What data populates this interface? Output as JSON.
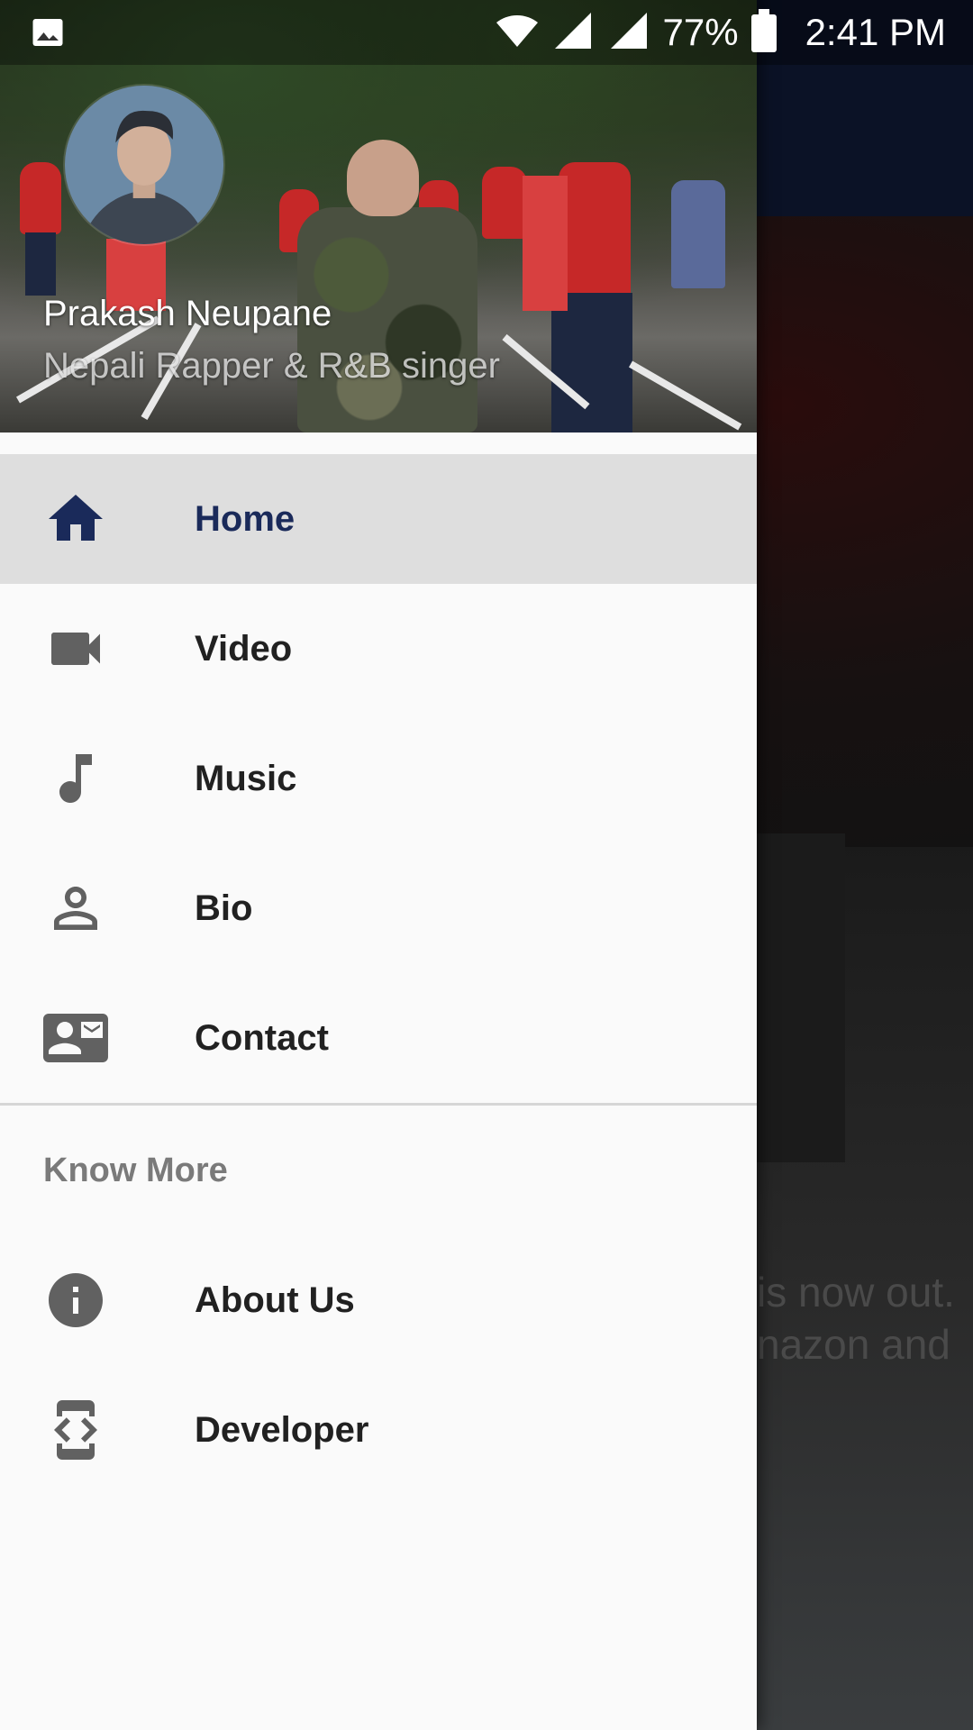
{
  "status_bar": {
    "battery_percent": "77%",
    "time": "2:41 PM"
  },
  "drawer": {
    "header": {
      "name": "Prakash Neupane",
      "subtitle": "Nepali Rapper & R&B singer"
    },
    "items": [
      {
        "label": "Home",
        "icon": "home-icon",
        "active": true
      },
      {
        "label": "Video",
        "icon": "videocam-icon",
        "active": false
      },
      {
        "label": "Music",
        "icon": "music-note-icon",
        "active": false
      },
      {
        "label": "Bio",
        "icon": "person-icon",
        "active": false
      },
      {
        "label": "Contact",
        "icon": "contact-mail-icon",
        "active": false
      }
    ],
    "section": {
      "title": "Know More",
      "items": [
        {
          "label": "About Us",
          "icon": "info-icon"
        },
        {
          "label": "Developer",
          "icon": "developer-mode-icon"
        }
      ]
    }
  },
  "background_app": {
    "visible_text_line1": "is now out.",
    "visible_text_line2": "nazon and"
  },
  "colors": {
    "drawer_bg": "#fafafa",
    "active_item_bg": "#dedede",
    "active_accent": "#1a2a5a",
    "icon_gray": "#616161",
    "section_title": "#7a7a7a"
  }
}
